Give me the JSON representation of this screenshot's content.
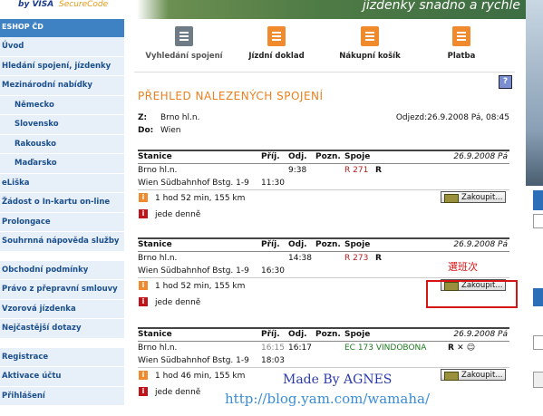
{
  "banner": {
    "visa": "by VISA",
    "secure": "SecureCode",
    "slogan": "jízdenky snadno a rychle"
  },
  "sidebar": {
    "head": "ESHOP ČD",
    "group1": [
      {
        "label": "Úvod",
        "sub": false
      },
      {
        "label": "Hledání spojení, jízdenky",
        "sub": false
      },
      {
        "label": "Mezinárodní nabídky",
        "sub": false
      },
      {
        "label": "Německo",
        "sub": true
      },
      {
        "label": "Slovensko",
        "sub": true
      },
      {
        "label": "Rakousko",
        "sub": true
      },
      {
        "label": "Maďarsko",
        "sub": true
      },
      {
        "label": "eLiška",
        "sub": false
      },
      {
        "label": "Žádost o In-kartu on-line",
        "sub": false
      },
      {
        "label": "Prolongace",
        "sub": false
      },
      {
        "label": "Souhrnná nápověda služby",
        "sub": false
      }
    ],
    "group2": [
      "Obchodní podmínky",
      "Právo z přepravní smlouvy",
      "Vzorová jízdenka",
      "Nejčastější dotazy"
    ],
    "group3": [
      "Registrace",
      "Aktivace účtu",
      "Přihlášení"
    ]
  },
  "steps": [
    "Vyhledání spojení",
    "Jízdní doklad",
    "Nákupní košík",
    "Platba"
  ],
  "help": "?",
  "title": "PŘEHLED NALEZENÝCH SPOJENÍ",
  "search": {
    "from_key": "Z:",
    "from": "Brno hl.n.",
    "to_key": "Do:",
    "to": "Wien",
    "departure": "Odjezd:26.9.2008 Pá, 08:45"
  },
  "columns": {
    "station": "Stanice",
    "arr": "Příj.",
    "dep": "Odj.",
    "note": "Pozn.",
    "trains": "Spoje"
  },
  "connections": [
    {
      "date": "26.9.2008 Pá",
      "rows": [
        {
          "station": "Brno hl.n.",
          "arr": "",
          "dep": "9:38",
          "train": "R 271",
          "extra": "R"
        },
        {
          "station": "Wien Südbahnhof Bstg. 1-9",
          "arr": "11:30",
          "dep": "",
          "train": "",
          "extra": ""
        }
      ],
      "duration": "1 hod 52 min, 155 km",
      "note": "jede denně",
      "buy": "Zakoupit..."
    },
    {
      "date": "26.9.2008 Pá",
      "rows": [
        {
          "station": "Brno hl.n.",
          "arr": "",
          "dep": "14:38",
          "train": "R 273",
          "extra": "R"
        },
        {
          "station": "Wien Südbahnhof Bstg. 1-9",
          "arr": "16:30",
          "dep": "",
          "train": "",
          "extra": ""
        }
      ],
      "duration": "1 hod 52 min, 155 km",
      "note": "jede denně",
      "buy": "Zakoupit..."
    },
    {
      "date": "26.9.2008 Pá",
      "rows": [
        {
          "station": "Brno hl.n.",
          "arr": "16:15",
          "dep": "16:17",
          "train": "EC 173 VINDOBONA",
          "extra": "R ✕ ☺"
        },
        {
          "station": "Wien Südbahnhof Bstg. 1-9",
          "arr": "18:03",
          "dep": "",
          "train": "",
          "extra": ""
        }
      ],
      "duration": "1 hod 46 min, 155 km",
      "note": "jede denně",
      "buy": "Zakoupit..."
    }
  ],
  "annotation": "選班次",
  "watermark": {
    "line1": "Made By AGNES",
    "line2": "http://blog.yam.com/wamaha/"
  }
}
